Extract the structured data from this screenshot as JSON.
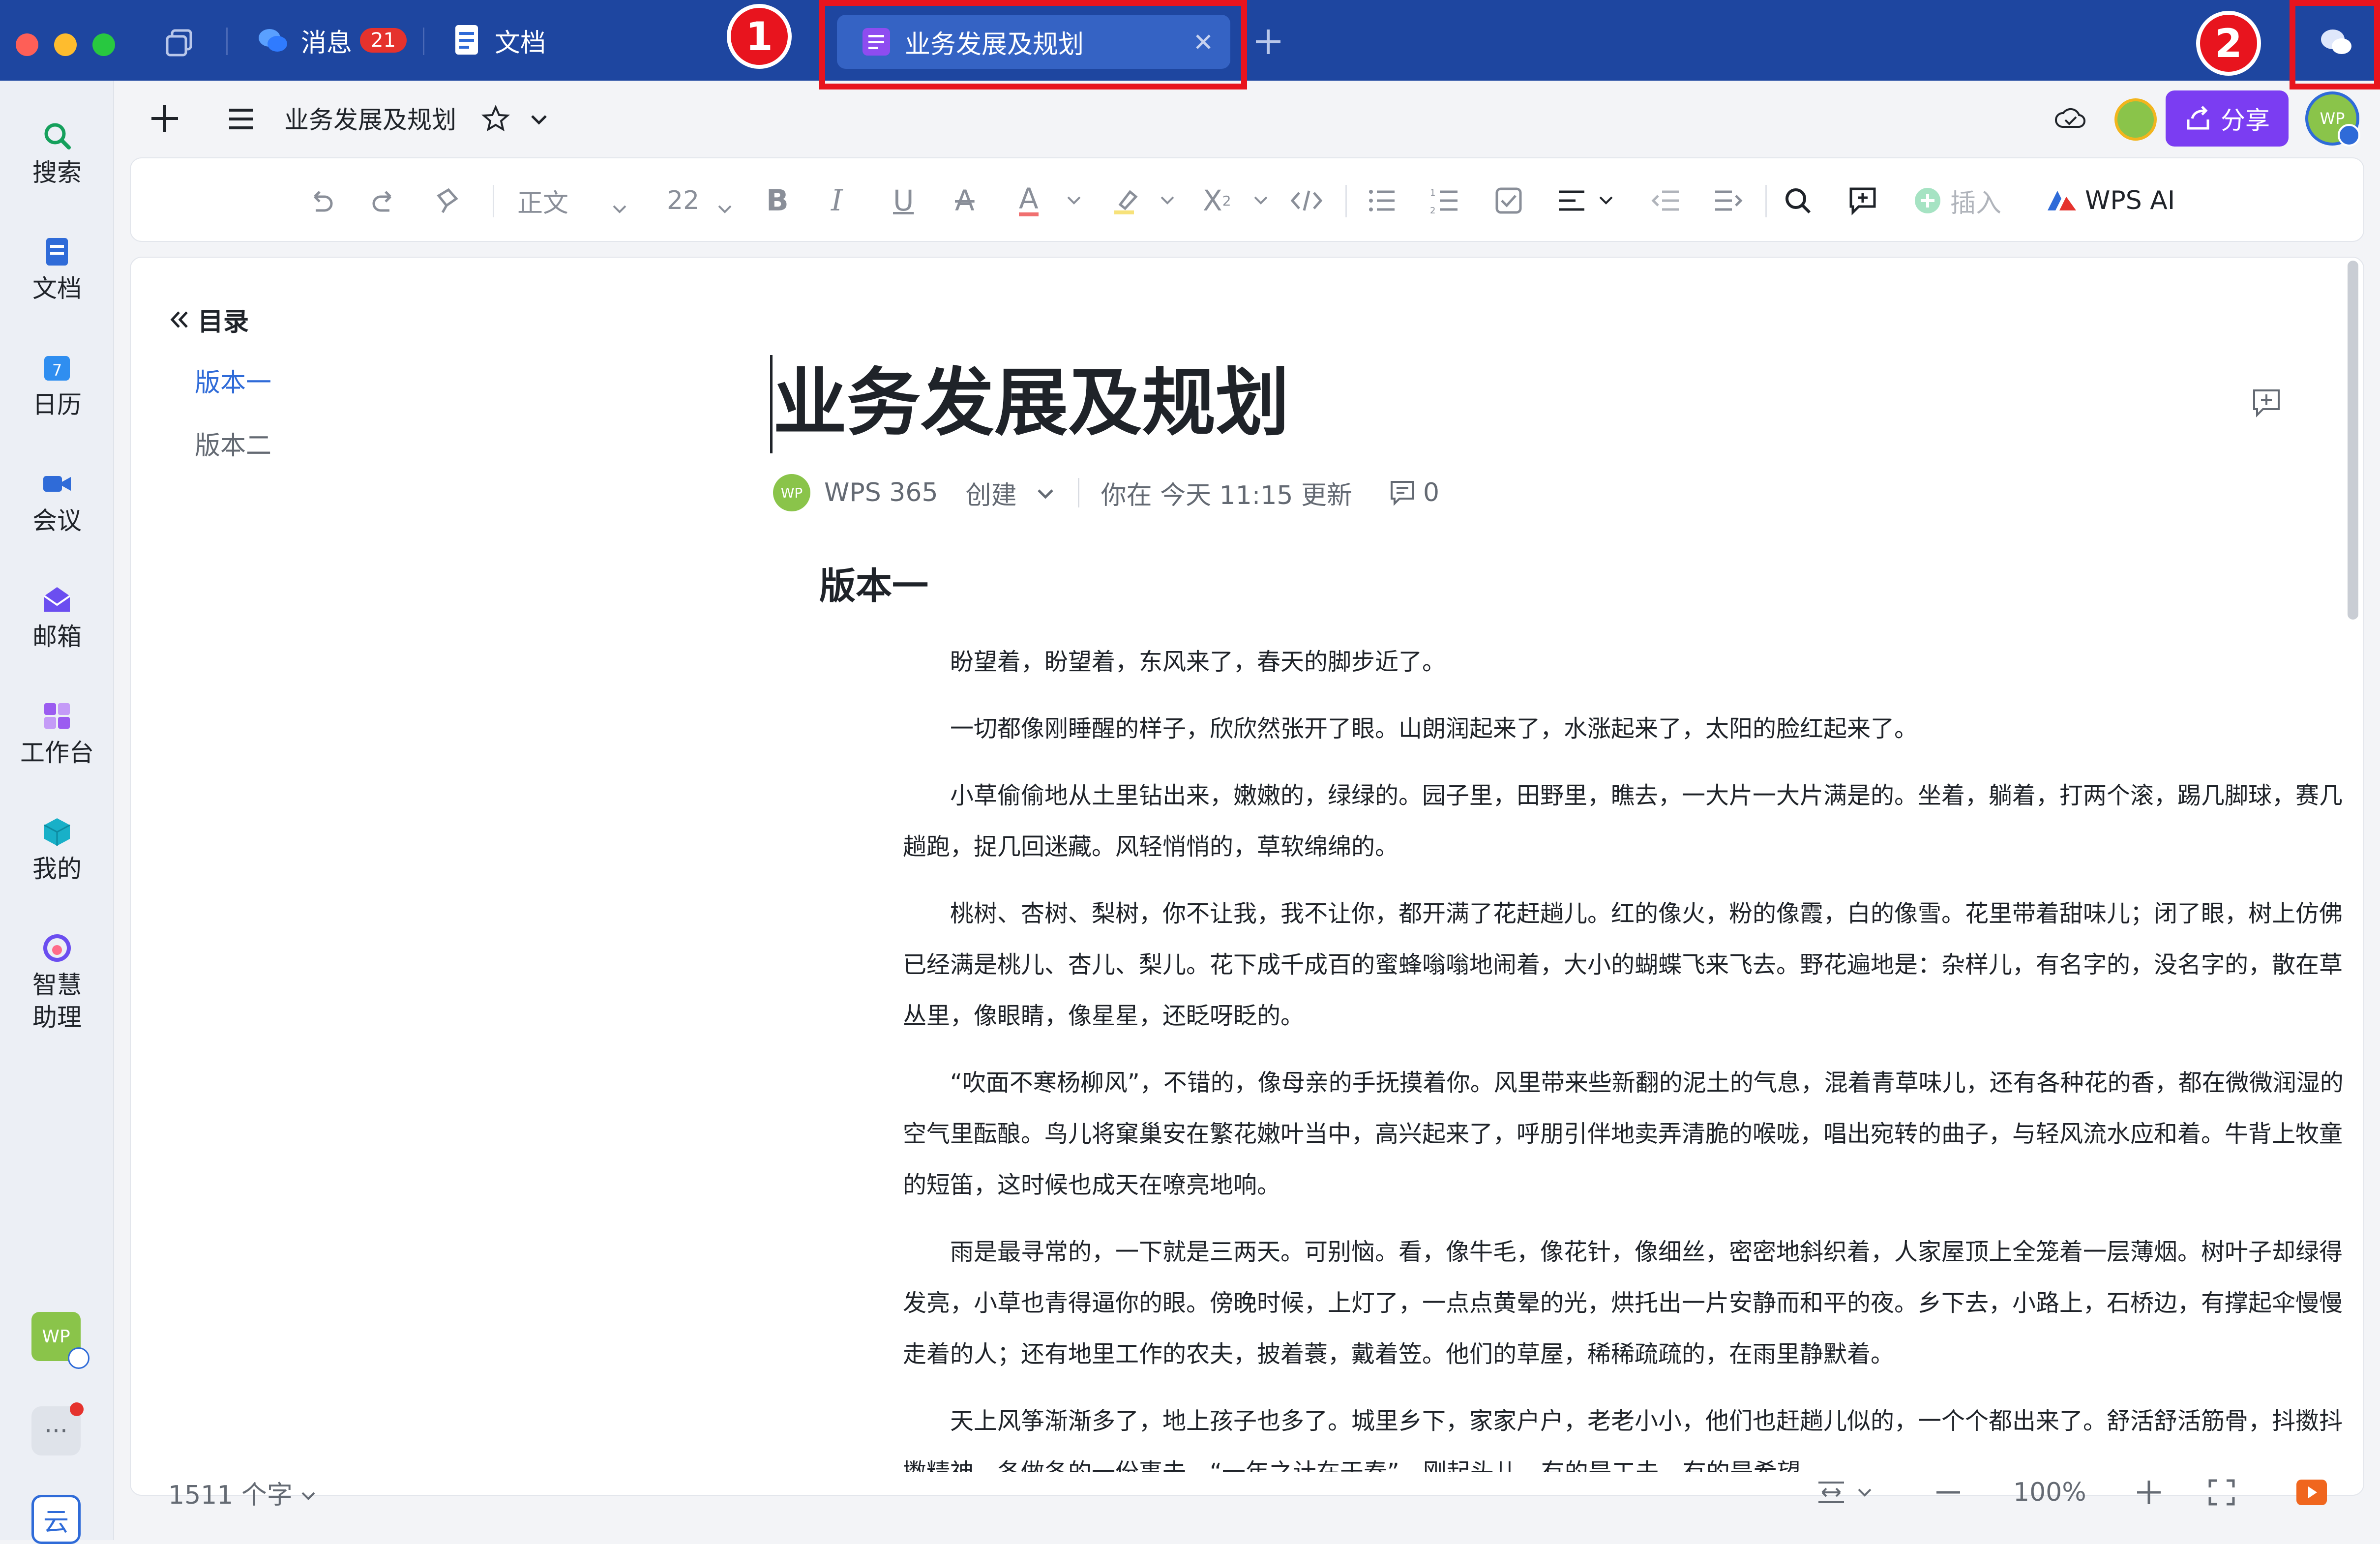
{
  "titlebar": {
    "messages_tab": "消息",
    "messages_badge": "21",
    "docs_tab": "文档",
    "active_tab": "业务发展及规划",
    "annotation_1": "1",
    "annotation_2": "2"
  },
  "sidebar": {
    "items": [
      {
        "label": "搜索"
      },
      {
        "label": "文档"
      },
      {
        "label": "日历"
      },
      {
        "label": "会议"
      },
      {
        "label": "邮箱"
      },
      {
        "label": "工作台"
      },
      {
        "label": "我的"
      },
      {
        "label": "智慧\n助理"
      }
    ],
    "avatar_text": "WP",
    "more_label": "···",
    "cloud_label": "云"
  },
  "toolbar1": {
    "doc_title": "业务发展及规划",
    "share_label": "分享",
    "avatar_text": "WP"
  },
  "toolbar2": {
    "style_label": "正文",
    "font_size": "22",
    "insert_label": "插入",
    "ai_label": "WPS AI"
  },
  "toc": {
    "header": "目录",
    "items": [
      "版本一",
      "版本二"
    ]
  },
  "doc": {
    "title": "业务发展及规划",
    "author_avatar": "WP",
    "author": "WPS 365",
    "created_label": "创建",
    "updated_text": "你在 今天 11:15 更新",
    "comment_count": "0",
    "heading1": "版本一",
    "paragraphs": [
      "盼望着，盼望着，东风来了，春天的脚步近了。",
      "一切都像刚睡醒的样子，欣欣然张开了眼。山朗润起来了，水涨起来了，太阳的脸红起来了。",
      "小草偷偷地从土里钻出来，嫩嫩的，绿绿的。园子里，田野里，瞧去，一大片一大片满是的。坐着，躺着，打两个滚，踢几脚球，赛几趟跑，捉几回迷藏。风轻悄悄的，草软绵绵的。",
      "桃树、杏树、梨树，你不让我，我不让你，都开满了花赶趟儿。红的像火，粉的像霞，白的像雪。花里带着甜味儿；闭了眼，树上仿佛已经满是桃儿、杏儿、梨儿。花下成千成百的蜜蜂嗡嗡地闹着，大小的蝴蝶飞来飞去。野花遍地是：杂样儿，有名字的，没名字的，散在草丛里，像眼睛，像星星，还眨呀眨的。",
      "“吹面不寒杨柳风”，不错的，像母亲的手抚摸着你。风里带来些新翻的泥土的气息，混着青草味儿，还有各种花的香，都在微微润湿的空气里酝酿。鸟儿将窠巢安在繁花嫩叶当中，高兴起来了，呼朋引伴地卖弄清脆的喉咙，唱出宛转的曲子，与轻风流水应和着。牛背上牧童的短笛，这时候也成天在嘹亮地响。",
      "雨是最寻常的，一下就是三两天。可别恼。看，像牛毛，像花针，像细丝，密密地斜织着，人家屋顶上全笼着一层薄烟。树叶子却绿得发亮，小草也青得逼你的眼。傍晚时候，上灯了，一点点黄晕的光，烘托出一片安静而和平的夜。乡下去，小路上，石桥边，有撑起伞慢慢走着的人；还有地里工作的农夫，披着蓑，戴着笠。他们的草屋，稀稀疏疏的，在雨里静默着。",
      "天上风筝渐渐多了，地上孩子也多了。城里乡下，家家户户，老老小小，他们也赶趟儿似的，一个个都出来了。舒活舒活筋骨，抖擞抖擞精神，各做各的一份事去。“一年之计在于春”，刚起头儿，有的是工夫，有的是希望。"
    ]
  },
  "status": {
    "word_count": "1511 个字",
    "zoom": "100%"
  },
  "colors": {
    "titlebar": "#1e46a0",
    "accent": "#2f6bd8",
    "share": "#7b3df2",
    "annotation": "#e8141e"
  }
}
